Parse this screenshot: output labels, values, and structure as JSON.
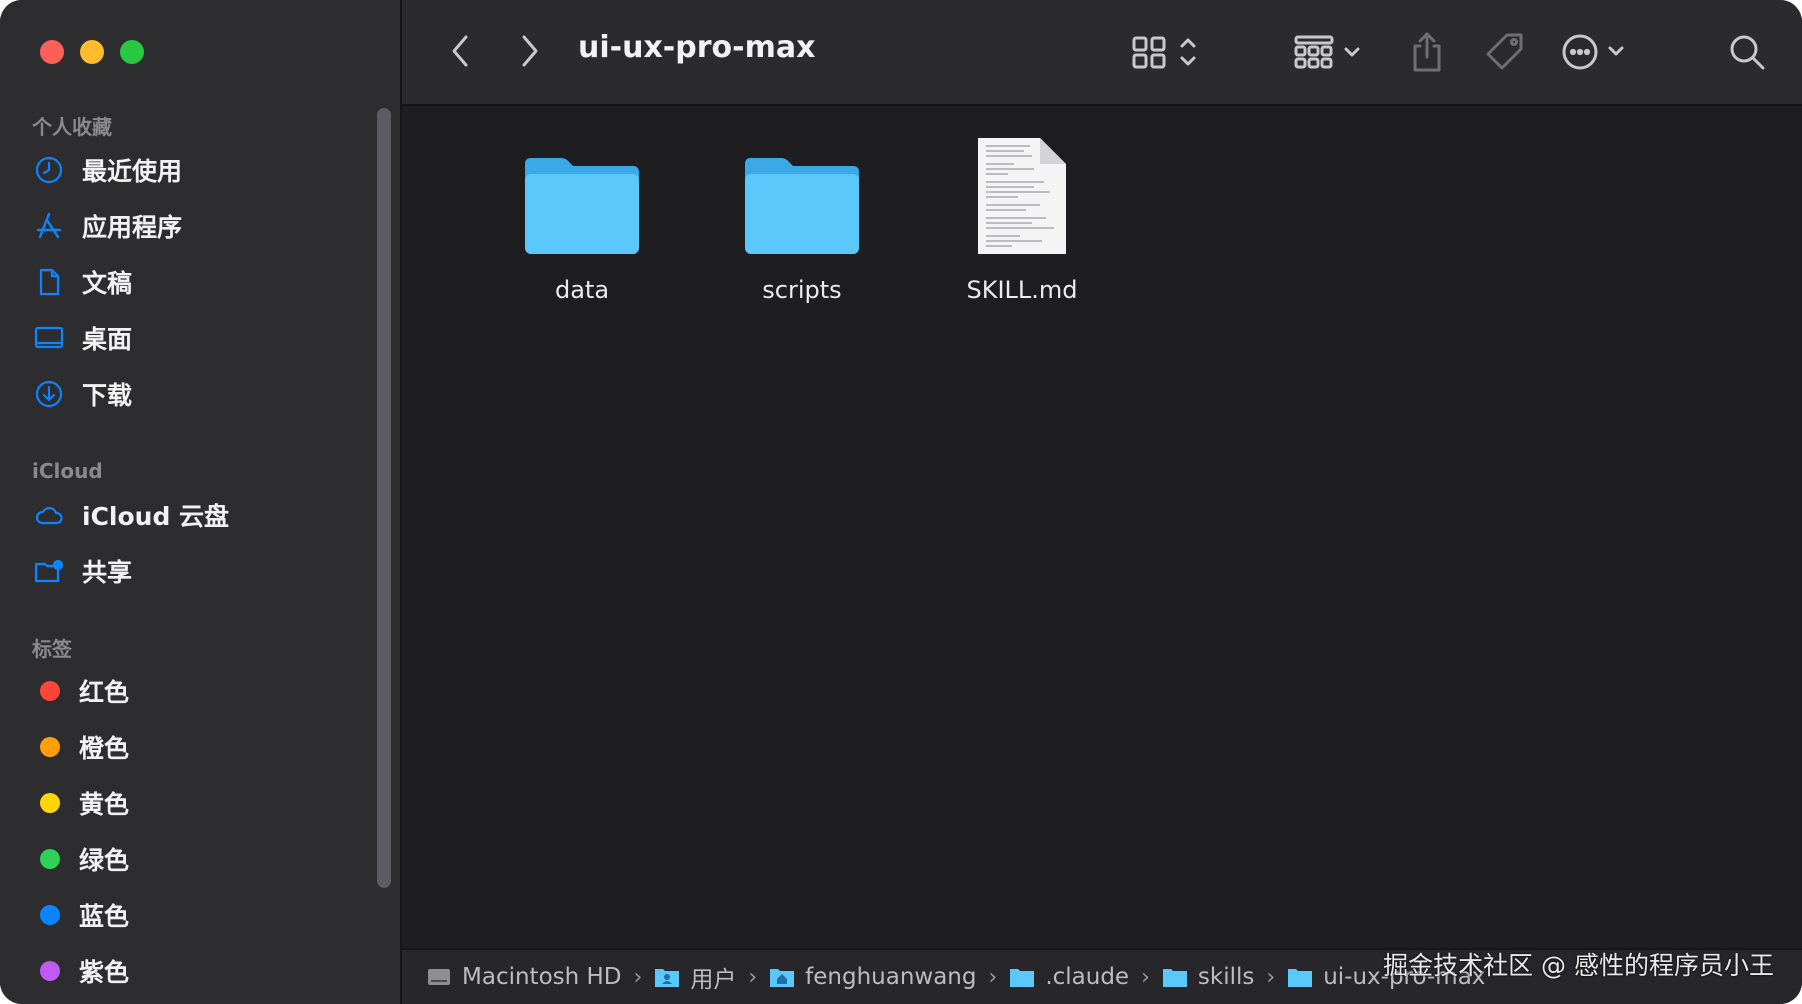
{
  "window": {
    "title": "ui-ux-pro-max",
    "traffic_lights": [
      "close",
      "minimize",
      "zoom"
    ]
  },
  "sidebar": {
    "favorites_title": "个人收藏",
    "favorites": [
      {
        "label": "最近使用",
        "icon": "clock-icon"
      },
      {
        "label": "应用程序",
        "icon": "applications-icon"
      },
      {
        "label": "文稿",
        "icon": "document-icon"
      },
      {
        "label": "桌面",
        "icon": "desktop-icon"
      },
      {
        "label": "下载",
        "icon": "download-icon"
      }
    ],
    "icloud_title": "iCloud",
    "icloud": [
      {
        "label": "iCloud 云盘",
        "icon": "cloud-icon"
      },
      {
        "label": "共享",
        "icon": "shared-folder-icon"
      }
    ],
    "tags_title": "标签",
    "tags": [
      {
        "label": "红色",
        "color": "#ff453a"
      },
      {
        "label": "橙色",
        "color": "#ff9f0a"
      },
      {
        "label": "黄色",
        "color": "#ffd60a"
      },
      {
        "label": "绿色",
        "color": "#30d158"
      },
      {
        "label": "蓝色",
        "color": "#0a84ff"
      },
      {
        "label": "紫色",
        "color": "#bf5af2"
      }
    ]
  },
  "toolbar": {
    "icons": [
      "back-icon",
      "forward-icon",
      "grid-view-icon",
      "group-icon",
      "share-icon",
      "tag-icon",
      "more-icon",
      "search-icon"
    ]
  },
  "files": [
    {
      "name": "data",
      "type": "folder"
    },
    {
      "name": "scripts",
      "type": "folder"
    },
    {
      "name": "SKILL.md",
      "type": "document"
    }
  ],
  "pathbar": [
    {
      "label": "Macintosh HD",
      "icon": "disk-icon"
    },
    {
      "label": "用户",
      "icon": "users-folder-icon"
    },
    {
      "label": "fenghuanwang",
      "icon": "home-folder-icon"
    },
    {
      "label": ".claude",
      "icon": "folder-icon"
    },
    {
      "label": "skills",
      "icon": "folder-icon"
    },
    {
      "label": "ui-ux-pro-max",
      "icon": "folder-icon"
    }
  ],
  "watermark": "掘金技术社区 @ 感性的程序员小王",
  "colors": {
    "accent": "#0a84ff",
    "folder": "#5ac8fa",
    "sidebar_bg": "#2d2c2f",
    "content_bg": "#1e1e20"
  }
}
